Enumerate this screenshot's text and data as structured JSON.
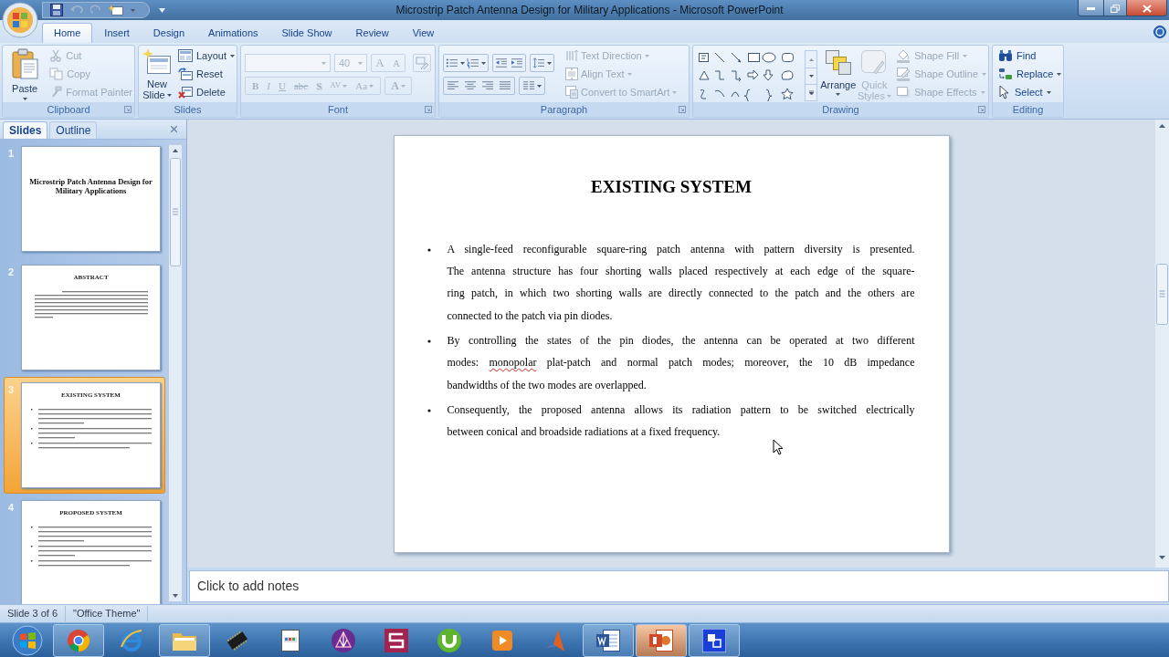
{
  "window": {
    "title": "Microstrip Patch Antenna Design for Military Applications - Microsoft PowerPoint"
  },
  "ribbon_tabs": [
    {
      "label": "Home",
      "selected": true
    },
    {
      "label": "Insert",
      "selected": false
    },
    {
      "label": "Design",
      "selected": false
    },
    {
      "label": "Animations",
      "selected": false
    },
    {
      "label": "Slide Show",
      "selected": false
    },
    {
      "label": "Review",
      "selected": false
    },
    {
      "label": "View",
      "selected": false
    }
  ],
  "clipboard": {
    "label": "Clipboard",
    "paste": {
      "label": "Paste",
      "disabled": false
    },
    "items": [
      {
        "kind": "cut",
        "label": "Cut",
        "disabled": true
      },
      {
        "kind": "copy",
        "label": "Copy",
        "disabled": true
      },
      {
        "kind": "format-painter",
        "label": "Format Painter",
        "disabled": true
      }
    ]
  },
  "slides_group": {
    "label": "Slides",
    "new_slide": {
      "label": "New",
      "label_2": "Slide"
    },
    "items": [
      {
        "kind": "layout",
        "label": "Layout",
        "dropdown": true
      },
      {
        "kind": "reset",
        "label": "Reset",
        "dropdown": false
      },
      {
        "kind": "delete",
        "label": "Delete",
        "dropdown": false
      }
    ]
  },
  "font": {
    "label": "Font",
    "disabled": true,
    "font_size": "40",
    "size_buttons": [
      {
        "kind": "grow",
        "label": "A"
      },
      {
        "kind": "shrink",
        "label": "A"
      }
    ],
    "format_buttons": [
      {
        "kind": "bold",
        "label": "B",
        "dropdown": false
      },
      {
        "kind": "italic",
        "label": "I",
        "dropdown": false
      },
      {
        "kind": "underline",
        "label": "U",
        "dropdown": false
      },
      {
        "kind": "strikethrough",
        "label": "abc",
        "dropdown": false
      },
      {
        "kind": "shadow",
        "label": "S",
        "dropdown": false
      },
      {
        "kind": "spacing",
        "label": "AV",
        "dropdown": true
      },
      {
        "kind": "case",
        "label": "Aa",
        "dropdown": true
      }
    ],
    "color_button": {
      "label": "A"
    }
  },
  "paragraph": {
    "label": "Paragraph",
    "items": [
      {
        "kind": "text-direction",
        "label": "Text Direction",
        "disabled": true
      },
      {
        "kind": "align-text",
        "label": "Align Text",
        "disabled": true
      },
      {
        "kind": "smartart",
        "label": "Convert to SmartArt",
        "disabled": true
      }
    ]
  },
  "drawing": {
    "label": "Drawing",
    "arrange": {
      "label": "Arrange",
      "disabled": false
    },
    "quick_styles": {
      "label": "Quick",
      "label_2": "Styles",
      "disabled": true
    },
    "items": [
      {
        "kind": "shape-fill",
        "label": "Shape Fill",
        "disabled": true
      },
      {
        "kind": "shape-outline",
        "label": "Shape Outline",
        "disabled": true
      },
      {
        "kind": "shape-effects",
        "label": "Shape Effects",
        "disabled": true
      }
    ]
  },
  "editing": {
    "label": "Editing",
    "items": [
      {
        "kind": "find",
        "label": "Find",
        "dropdown": false
      },
      {
        "kind": "replace",
        "label": "Replace",
        "dropdown": true
      },
      {
        "kind": "select",
        "label": "Select",
        "dropdown": true
      }
    ]
  },
  "slides_panel": {
    "tabs": [
      {
        "label": "Slides",
        "selected": true
      },
      {
        "label": "Outline",
        "selected": false
      }
    ],
    "thumbnails": [
      {
        "number": "1",
        "kind": "title",
        "title": "Microstrip Patch Antenna Design for Military Applications",
        "selected": false
      },
      {
        "number": "2",
        "kind": "paragraph",
        "title": "ABSTRACT",
        "selected": false
      },
      {
        "number": "3",
        "kind": "bullets",
        "title": "EXISTING SYSTEM",
        "selected": true
      },
      {
        "number": "4",
        "kind": "bullets",
        "title": "PROPOSED SYSTEM",
        "selected": false
      }
    ]
  },
  "slide": {
    "title": "EXISTING SYSTEM",
    "bullets": [
      {
        "lines": [
          [
            {
              "text": "A single-feed reconfigurable square-ring patch antenna with pattern diversity is presented.",
              "misspelled": false
            }
          ],
          [
            {
              "text": "The antenna structure has four shorting walls placed respectively at each edge of the square-",
              "misspelled": false
            }
          ],
          [
            {
              "text": "ring patch, in which two shorting walls are directly connected to the patch and the others are",
              "misspelled": false
            }
          ],
          [
            {
              "text": "connected to the patch via pin diodes.",
              "misspelled": false
            }
          ]
        ]
      },
      {
        "lines": [
          [
            {
              "text": "By controlling the states of the pin diodes, the antenna can be operated at two different",
              "misspelled": false
            }
          ],
          [
            {
              "text": "modes: ",
              "misspelled": false
            },
            {
              "text": "monopolar",
              "misspelled": true
            },
            {
              "text": " plat-patch and normal patch modes; moreover, the 10 dB impedance",
              "misspelled": false
            }
          ],
          [
            {
              "text": "bandwidths of the two modes are overlapped.",
              "misspelled": false
            }
          ]
        ]
      },
      {
        "lines": [
          [
            {
              "text": "Consequently, the proposed antenna allows its radiation pattern to be switched electrically",
              "misspelled": false
            }
          ],
          [
            {
              "text": "between conical and broadside radiations at a fixed frequency.",
              "misspelled": false
            }
          ]
        ]
      }
    ]
  },
  "notes": {
    "placeholder": "Click to add notes"
  },
  "status_bar": {
    "items": [
      "Slide 3 of 6",
      "\"Office Theme\""
    ]
  },
  "taskbar": {
    "items": [
      {
        "kind": "color-wheel",
        "running": true,
        "selected": false
      },
      {
        "kind": "ring",
        "running": false,
        "selected": false
      },
      {
        "kind": "folder",
        "running": true,
        "selected": false
      },
      {
        "kind": "chip",
        "running": false,
        "selected": false
      },
      {
        "kind": "document",
        "running": false,
        "selected": false
      },
      {
        "kind": "triangle-circle",
        "running": false,
        "selected": false
      },
      {
        "kind": "zigzag-square",
        "running": false,
        "selected": false
      },
      {
        "kind": "u-circle",
        "running": false,
        "selected": false
      },
      {
        "kind": "play",
        "running": false,
        "selected": false
      },
      {
        "kind": "peak",
        "running": false,
        "selected": false
      },
      {
        "kind": "document-badge",
        "running": true,
        "selected": false
      },
      {
        "kind": "document-chart",
        "running": true,
        "selected": true
      },
      {
        "kind": "window",
        "running": true,
        "selected": false
      }
    ]
  }
}
